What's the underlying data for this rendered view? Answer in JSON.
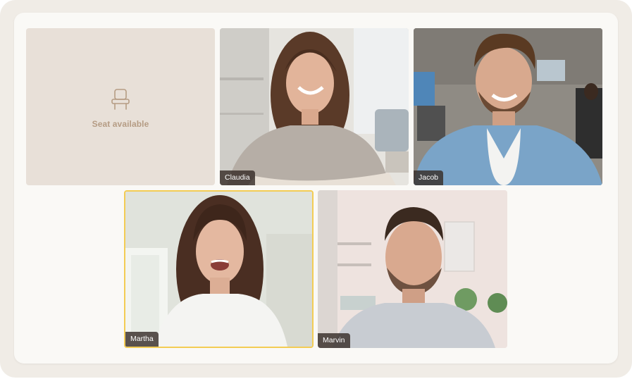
{
  "seat": {
    "label": "Seat available",
    "icon": "chair-icon"
  },
  "participants": [
    {
      "name": "Claudia"
    },
    {
      "name": "Jacob"
    },
    {
      "name": "Martha",
      "speaking": true
    },
    {
      "name": "Marvin"
    }
  ],
  "colors": {
    "outer_bg": "#f0ece6",
    "panel_bg": "#faf9f6",
    "empty_seat_bg": "#e8e0d8",
    "empty_seat_text": "#b59c84",
    "active_speaker_border": "#f3cc54",
    "name_tag_bg": "#372d28"
  }
}
